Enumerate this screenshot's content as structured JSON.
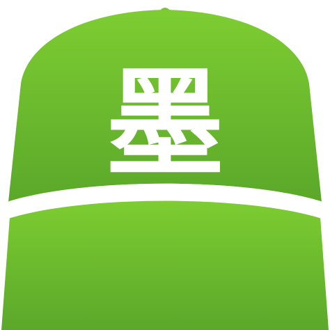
{
  "app_icon": {
    "glyph": "墨",
    "icon_name": "baseball-cap-icon",
    "colors": {
      "cap_top": "#7dcd32",
      "cap_bottom": "#5ba82a",
      "brim_stripe": "#ffffff",
      "glyph": "#ffffff",
      "background": "#ffffff"
    }
  }
}
